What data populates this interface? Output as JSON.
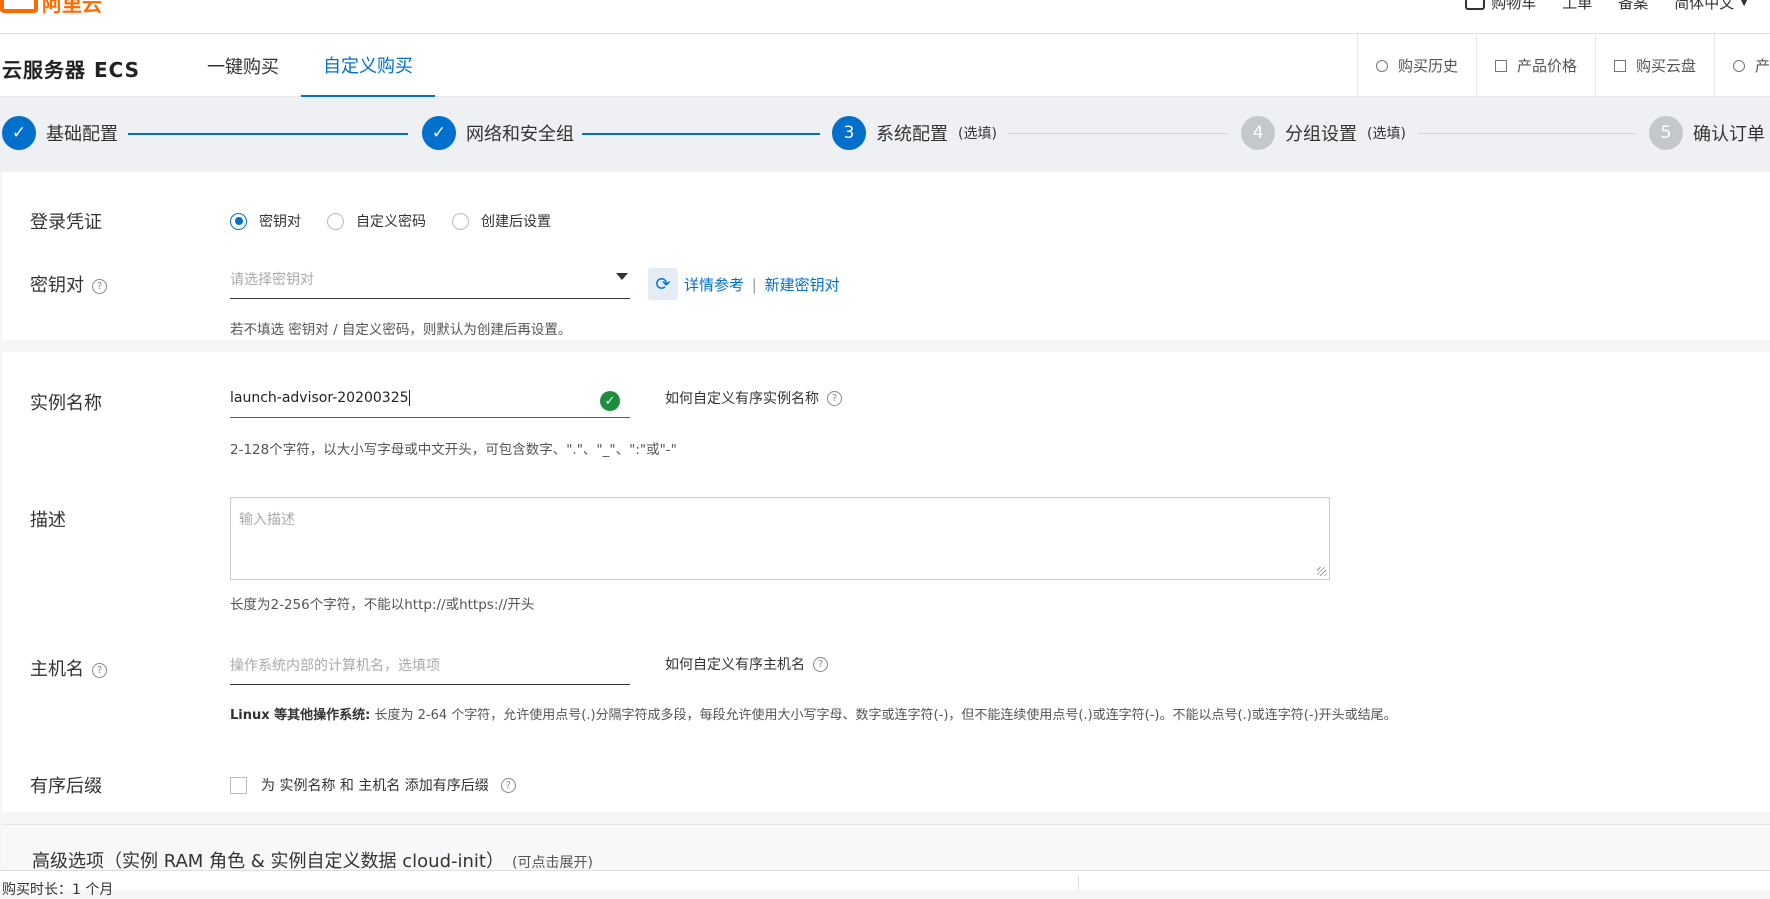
{
  "topbar": {
    "logo": "阿里云",
    "nav": [
      "购物车",
      "工单",
      "备案",
      "简体中文"
    ]
  },
  "header": {
    "title": "云服务器 ECS",
    "tabs": [
      {
        "label": "一键购买"
      },
      {
        "label": "自定义购买"
      }
    ],
    "actions": [
      "购买历史",
      "产品价格",
      "购买云盘",
      "产"
    ]
  },
  "steps": [
    {
      "num": "",
      "label": "基础配置",
      "opt": "",
      "state": "done"
    },
    {
      "num": "",
      "label": "网络和安全组",
      "opt": "",
      "state": "done"
    },
    {
      "num": "3",
      "label": "系统配置",
      "opt": "(选填)",
      "state": "current"
    },
    {
      "num": "4",
      "label": "分组设置",
      "opt": "(选填)",
      "state": "todo"
    },
    {
      "num": "5",
      "label": "确认订单",
      "opt": "",
      "state": "todo"
    }
  ],
  "login": {
    "label": "登录凭证",
    "options": [
      "密钥对",
      "自定义密码",
      "创建后设置"
    ],
    "selected": 0
  },
  "keypair": {
    "label": "密钥对",
    "placeholder": "请选择密钥对",
    "link_detail": "详情参考",
    "separator": "|",
    "link_new": "新建密钥对",
    "help": "若不填选 密钥对 / 自定义密码，则默认为创建后再设置。"
  },
  "instance_name": {
    "label": "实例名称",
    "value": "launch-advisor-20200325",
    "hint": "如何自定义有序实例名称",
    "help": "2-128个字符，以大小写字母或中文开头，可包含数字、\".\"、\"_\"、\":\"或\"-\""
  },
  "description": {
    "label": "描述",
    "placeholder": "输入描述",
    "help": "长度为2-256个字符，不能以http://或https://开头"
  },
  "hostname": {
    "label": "主机名",
    "placeholder": "操作系统内部的计算机名，选填项",
    "hint": "如何自定义有序主机名",
    "help_bold": "Linux 等其他操作系统:",
    "help": " 长度为 2-64 个字符，允许使用点号(.)分隔字符成多段，每段允许使用大小写字母、数字或连字符(-)，但不能连续使用点号(.)或连字符(-)。不能以点号(.)或连字符(-)开头或结尾。"
  },
  "suffix": {
    "label": "有序后缀",
    "checkbox_label": "为 实例名称 和 主机名 添加有序后缀"
  },
  "advanced": {
    "title": "高级选项（实例 RAM 角色 & 实例自定义数据 cloud-init）",
    "sub": "(可点击展开)"
  },
  "footer": {
    "duration": "购买时长：1 个月"
  },
  "colors": {
    "accent": "#0070cc",
    "success": "#1e8e3e",
    "brand": "#ff6a00"
  }
}
